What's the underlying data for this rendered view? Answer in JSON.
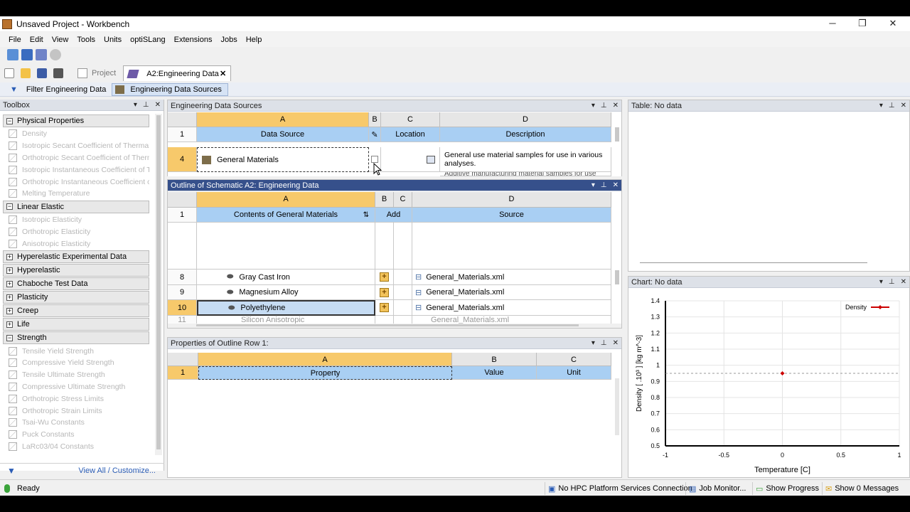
{
  "window": {
    "title": "Unsaved Project - Workbench",
    "minimize_glyph": "─",
    "restore_glyph": "❐",
    "close_glyph": "✕"
  },
  "menu": [
    "File",
    "Edit",
    "View",
    "Tools",
    "Units",
    "optiSLang",
    "Extensions",
    "Jobs",
    "Help"
  ],
  "tabs": [
    {
      "label": "Project",
      "active": false
    },
    {
      "label": "A2:Engineering Data",
      "active": true
    }
  ],
  "subtoolbar": {
    "filter_label": "Filter Engineering Data",
    "sources_label": "Engineering Data Sources"
  },
  "toolbox": {
    "title": "Toolbox",
    "groups": [
      {
        "label": "Physical Properties",
        "expanded": true,
        "items": [
          "Density",
          "Isotropic Secant Coefficient of Thermal Expansion",
          "Orthotropic Secant Coefficient of Thermal Expansion",
          "Isotropic Instantaneous Coefficient of Thermal Expansion",
          "Orthotropic Instantaneous Coefficient of Thermal Expansion",
          "Melting Temperature"
        ]
      },
      {
        "label": "Linear Elastic",
        "expanded": true,
        "items": [
          "Isotropic Elasticity",
          "Orthotropic Elasticity",
          "Anisotropic Elasticity"
        ]
      },
      {
        "label": "Hyperelastic Experimental Data",
        "expanded": false,
        "items": []
      },
      {
        "label": "Hyperelastic",
        "expanded": false,
        "items": []
      },
      {
        "label": "Chaboche Test Data",
        "expanded": false,
        "items": []
      },
      {
        "label": "Plasticity",
        "expanded": false,
        "items": []
      },
      {
        "label": "Creep",
        "expanded": false,
        "items": []
      },
      {
        "label": "Life",
        "expanded": false,
        "items": []
      },
      {
        "label": "Strength",
        "expanded": true,
        "items": [
          "Tensile Yield Strength",
          "Compressive Yield Strength",
          "Tensile Ultimate Strength",
          "Compressive Ultimate Strength",
          "Orthotropic Stress Limits",
          "Orthotropic Strain Limits",
          "Tsai-Wu Constants",
          "Puck Constants",
          "LaRc03/04 Constants"
        ]
      }
    ],
    "footer_link": "View All / Customize..."
  },
  "eds_panel": {
    "title": "Engineering Data Sources",
    "columns": [
      "A",
      "B",
      "C",
      "D"
    ],
    "header_row": {
      "num": "1",
      "a": "Data Source",
      "c": "Location",
      "d": "Description"
    },
    "rows": [
      {
        "num": "4",
        "a": "General Materials",
        "d": "General use material samples for use in various analyses."
      },
      {
        "num": "",
        "a": "",
        "d": "Additive manufacturing material samples for use"
      }
    ]
  },
  "outline_panel": {
    "title": "Outline of Schematic A2: Engineering Data",
    "columns": [
      "A",
      "B",
      "C",
      "D"
    ],
    "header_row": {
      "num": "1",
      "a": "Contents of General Materials",
      "b": "Add",
      "d": "Source"
    },
    "rows": [
      {
        "num": "8",
        "a": "Gray Cast Iron",
        "d": "General_Materials.xml"
      },
      {
        "num": "9",
        "a": "Magnesium Alloy",
        "d": "General_Materials.xml"
      },
      {
        "num": "10",
        "a": "Polyethylene",
        "d": "General_Materials.xml",
        "selected": true
      },
      {
        "num": "11",
        "a": "Silicon Anisotropic",
        "d": "General_Materials.xml"
      }
    ]
  },
  "props_panel": {
    "title": "Properties of Outline Row 1:",
    "columns": [
      "A",
      "B",
      "C"
    ],
    "header_row": {
      "num": "1",
      "a": "Property",
      "b": "Value",
      "c": "Unit"
    }
  },
  "table_panel": {
    "title": "Table: No data"
  },
  "chart_panel": {
    "title": "Chart: No data"
  },
  "chart_data": {
    "type": "scatter",
    "series": [
      {
        "name": "Density",
        "color": "#cc0000",
        "values": [
          {
            "x": 0,
            "y": 0.95
          }
        ]
      }
    ],
    "x": [
      0
    ],
    "xlabel": "Temperature  [C]",
    "ylabel": "Density  [ .10³ ]  [kg m^-3]",
    "xlim": [
      -1,
      1
    ],
    "ylim": [
      0.5,
      1.4
    ],
    "xticks": [
      "-1",
      "-0.5",
      "0",
      "0.5",
      "1"
    ],
    "yticks": [
      "0.5",
      "0.6",
      "0.7",
      "0.8",
      "0.9",
      "1",
      "1.1",
      "1.2",
      "1.3",
      "1.4"
    ],
    "reference_line_y": 0.95,
    "legend": "top-right",
    "grid": true
  },
  "status": {
    "text": "Ready",
    "buttons": [
      "No HPC Platform Services Connection",
      "Job Monitor...",
      "Show Progress",
      "Show 0 Messages"
    ]
  }
}
